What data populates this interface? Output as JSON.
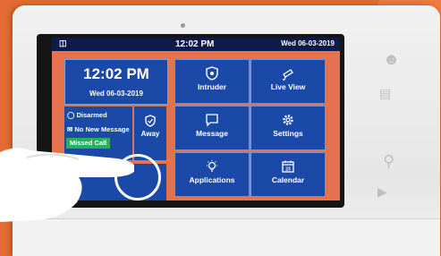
{
  "statusbar": {
    "time": "12:02 PM",
    "date": "Wed  06-03-2019"
  },
  "clock": {
    "time": "12:02 PM",
    "date": "Wed 06-03-2019"
  },
  "status": {
    "armed": "Disarmed",
    "messages": "No New Message",
    "calls": "Missed Call"
  },
  "away": {
    "label": "Away"
  },
  "tiles": [
    {
      "label": "Intruder",
      "icon": "shield-icon"
    },
    {
      "label": "Live View",
      "icon": "camera-icon"
    },
    {
      "label": "Message",
      "icon": "message-icon"
    },
    {
      "label": "Settings",
      "icon": "gear-icon"
    },
    {
      "label": "Applications",
      "icon": "bulb-icon"
    },
    {
      "label": "Calendar",
      "icon": "calendar-icon"
    }
  ],
  "colors": {
    "tile": "#1b49a8",
    "background": "#e46a33",
    "missed_call": "#27b060"
  }
}
